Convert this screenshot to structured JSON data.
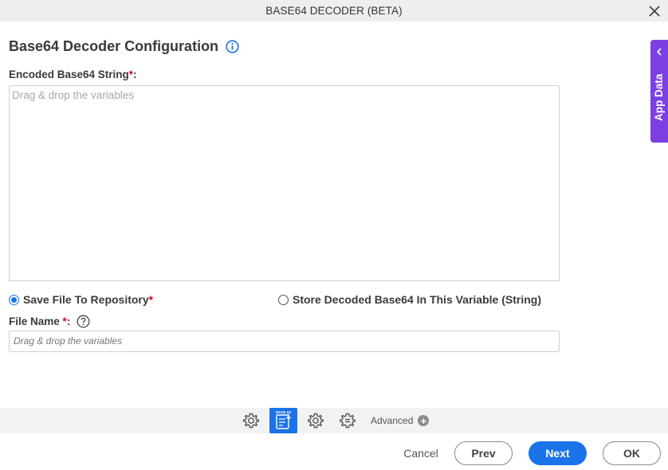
{
  "window": {
    "title": "BASE64 DECODER (BETA)"
  },
  "form": {
    "heading": "Base64 Decoder Configuration",
    "encoded_label": "Encoded Base64 String",
    "encoded_required": "*",
    "encoded_colon": ":",
    "encoded_placeholder": "Drag & drop the variables",
    "radio_save_label": "Save File To Repository",
    "radio_save_required": "*",
    "radio_save_selected": true,
    "radio_store_label": "Store Decoded Base64 In This Variable (String)",
    "radio_store_selected": false,
    "file_name_label": "File Name",
    "file_name_required": "*",
    "file_name_colon": " :",
    "file_name_placeholder": "Drag & drop the variables"
  },
  "side_panel": {
    "label": "App Data"
  },
  "toolbar": {
    "active_icon_caption": "BASE 64",
    "advanced_label": "Advanced"
  },
  "footer": {
    "cancel": "Cancel",
    "prev": "Prev",
    "next": "Next",
    "ok": "OK"
  },
  "colors": {
    "accent": "#1a73e8",
    "side_panel": "#7b3fe4",
    "required": "#d0021b"
  }
}
